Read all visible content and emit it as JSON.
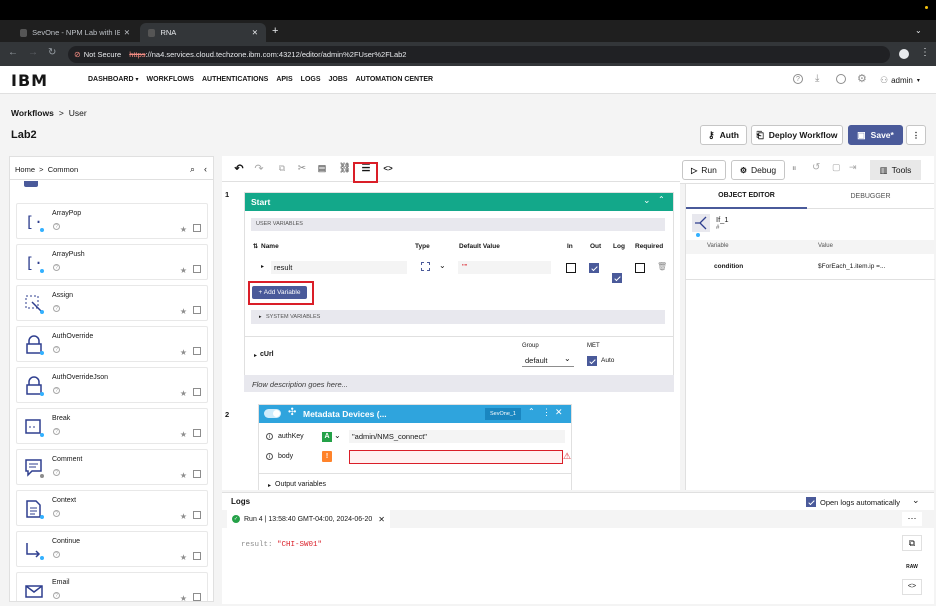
{
  "browser": {
    "tabs": [
      {
        "title": "SevOne - NPM Lab with IBM (",
        "active": false
      },
      {
        "title": "RNA",
        "active": true
      }
    ],
    "security": "Not Secure",
    "url_scheme": "https",
    "url_rest": "://na4.services.cloud.techzone.ibm.com:43212/editor/admin%2FUser%2FLab2"
  },
  "app": {
    "logo": "IBM",
    "nav": [
      "DASHBOARD",
      "WORKFLOWS",
      "AUTHENTICATIONS",
      "APIS",
      "LOGS",
      "JOBS",
      "AUTOMATION CENTER"
    ],
    "user": "admin"
  },
  "page": {
    "breadcrumb_root": "Workflows",
    "breadcrumb_leaf": "User",
    "title": "Lab2",
    "auth_label": "Auth",
    "deploy_label": "Deploy Workflow",
    "save_label": "Save*"
  },
  "left_panel": {
    "breadcrumb": "Home  >  Common",
    "items": [
      {
        "name": "ArrayPop",
        "icon": "array-icon"
      },
      {
        "name": "ArrayPush",
        "icon": "array-icon"
      },
      {
        "name": "Assign",
        "icon": "assign-icon"
      },
      {
        "name": "AuthOverride",
        "icon": "lock-icon"
      },
      {
        "name": "AuthOverrideJson",
        "icon": "lock-icon"
      },
      {
        "name": "Break",
        "icon": "break-icon"
      },
      {
        "name": "Comment",
        "icon": "comment-icon"
      },
      {
        "name": "Context",
        "icon": "document-icon"
      },
      {
        "name": "Continue",
        "icon": "continue-icon"
      },
      {
        "name": "Email",
        "icon": "email-icon"
      }
    ]
  },
  "toolbar": {
    "run_label": "Run",
    "debug_label": "Debug",
    "tools_label": "Tools"
  },
  "canvas": {
    "step1": "1",
    "step2": "2",
    "start_title": "Start",
    "user_variables_label": "USER VARIABLES",
    "columns": [
      "Name",
      "Type",
      "Default Value",
      "In",
      "Out",
      "Log",
      "Required"
    ],
    "variable_name": "result",
    "variable_default": "\"\"",
    "add_variable_label": "+ Add Variable",
    "system_variables_label": "SYSTEM VARIABLES",
    "curl_label": "cUrl",
    "group_label": "Group",
    "group_value": "default",
    "met_label": "MET",
    "auto_label": "Auto",
    "flow_description": "Flow description goes here...",
    "node_title": "Metadata Devices (...",
    "node_badge": "SevOne_1",
    "auth_key_label": "authKey",
    "auth_key_badge": "A",
    "auth_key_value": "\"admin/NMS_connect\"",
    "body_label": "body",
    "body_badge": "!",
    "output_variables_label": "Output variables"
  },
  "object_editor": {
    "tab_editor": "OBJECT EDITOR",
    "tab_debugger": "DEBUGGER",
    "node_name": "If_1",
    "node_sub": "#",
    "col_variable": "Variable",
    "col_value": "Value",
    "row_variable": "condition",
    "row_value": "$ForEach_1.item.ip =..."
  },
  "logs": {
    "title": "Logs",
    "open_auto_label": "Open logs automatically",
    "run_tab": "Run 4 | 13:58:40 GMT-04:00, 2024-06-20",
    "result_key": "result: ",
    "result_value": "\"CHI-SW01\"",
    "raw_label": "RAW"
  },
  "colors": {
    "accent": "#4a5a9a",
    "start_green": "#13a88a",
    "node_blue": "#2fa4dd",
    "highlight_red": "#da1e28"
  }
}
